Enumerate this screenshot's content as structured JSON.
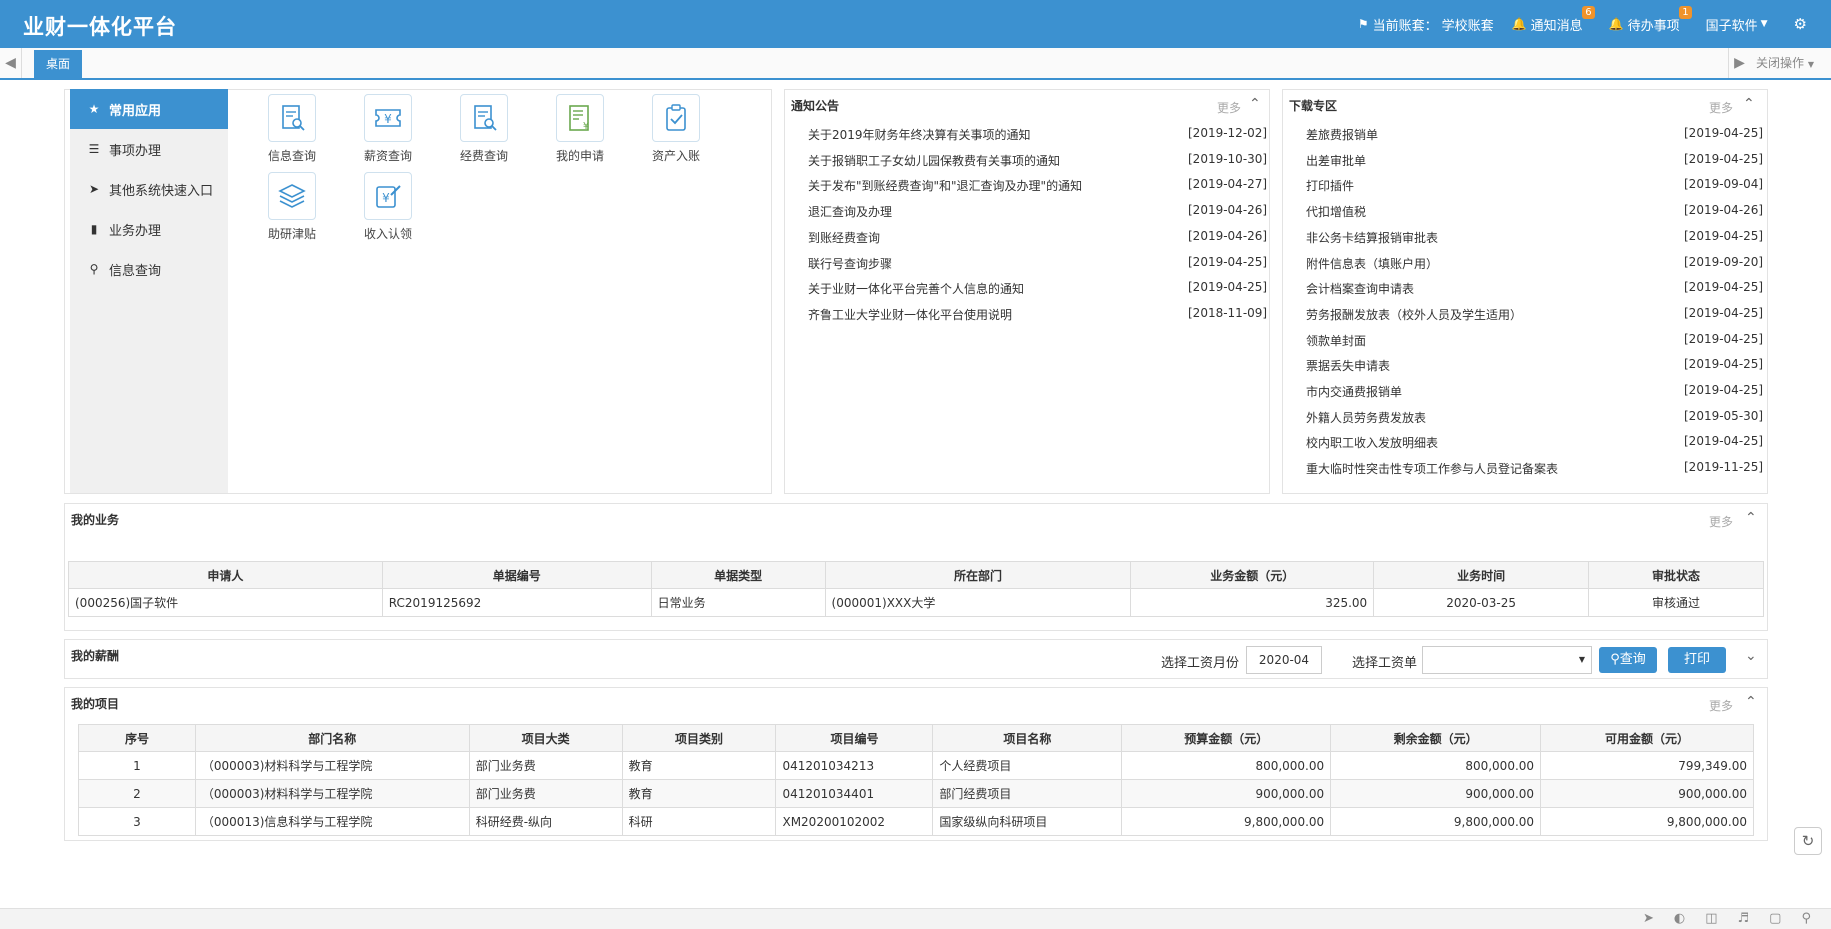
{
  "header": {
    "title": "业财一体化平台",
    "account_label": "当前账套：",
    "account_value": "学校账套",
    "notify_label": "通知消息",
    "notify_count": "6",
    "todo_label": "待办事项",
    "todo_count": "1",
    "user_label": "国子软件"
  },
  "tabs": {
    "active_tab": "桌面",
    "close_ops": "关闭操作"
  },
  "app_menu": {
    "items": [
      {
        "label": "常用应用",
        "icon": "star-icon"
      },
      {
        "label": "事项办理",
        "icon": "list-icon"
      },
      {
        "label": "其他系统快速入口",
        "icon": "arrow-up-circle-icon"
      },
      {
        "label": "业务办理",
        "icon": "book-icon"
      },
      {
        "label": "信息查询",
        "icon": "search-icon"
      }
    ]
  },
  "apps": [
    {
      "label": "信息查询",
      "icon": "document-search-icon"
    },
    {
      "label": "薪资查询",
      "icon": "yen-ticket-icon"
    },
    {
      "label": "经费查询",
      "icon": "document-search-icon"
    },
    {
      "label": "我的申请",
      "icon": "list-yen-icon"
    },
    {
      "label": "资产入账",
      "icon": "clipboard-check-icon"
    },
    {
      "label": "助研津贴",
      "icon": "layers-icon"
    },
    {
      "label": "收入认领",
      "icon": "yen-edit-icon"
    }
  ],
  "notices": {
    "title": "通知公告",
    "more": "更多",
    "items": [
      {
        "text": "关于2019年财务年终决算有关事项的通知",
        "date": "[2019-12-02]"
      },
      {
        "text": "关于报销职工子女幼儿园保教费有关事项的通知",
        "date": "[2019-10-30]"
      },
      {
        "text": "关于发布\"到账经费查询\"和\"退汇查询及办理\"的通知",
        "date": "[2019-04-27]"
      },
      {
        "text": "退汇查询及办理",
        "date": "[2019-04-26]"
      },
      {
        "text": "到账经费查询",
        "date": "[2019-04-26]"
      },
      {
        "text": "联行号查询步骤",
        "date": "[2019-04-25]"
      },
      {
        "text": "关于业财一体化平台完善个人信息的通知",
        "date": "[2019-04-25]"
      },
      {
        "text": "齐鲁工业大学业财一体化平台使用说明",
        "date": "[2018-11-09]"
      }
    ]
  },
  "downloads": {
    "title": "下载专区",
    "more": "更多",
    "items": [
      {
        "text": "差旅费报销单",
        "date": "[2019-04-25]"
      },
      {
        "text": "出差审批单",
        "date": "[2019-04-25]"
      },
      {
        "text": "打印插件",
        "date": "[2019-09-04]"
      },
      {
        "text": "代扣增值税",
        "date": "[2019-04-26]"
      },
      {
        "text": "非公务卡结算报销审批表",
        "date": "[2019-04-25]"
      },
      {
        "text": "附件信息表（填账户用）",
        "date": "[2019-09-20]"
      },
      {
        "text": "会计档案查询申请表",
        "date": "[2019-04-25]"
      },
      {
        "text": "劳务报酬发放表（校外人员及学生适用）",
        "date": "[2019-04-25]"
      },
      {
        "text": "领款单封面",
        "date": "[2019-04-25]"
      },
      {
        "text": "票据丢失申请表",
        "date": "[2019-04-25]"
      },
      {
        "text": "市内交通费报销单",
        "date": "[2019-04-25]"
      },
      {
        "text": "外籍人员劳务费发放表",
        "date": "[2019-05-30]"
      },
      {
        "text": "校内职工收入发放明细表",
        "date": "[2019-04-25]"
      },
      {
        "text": "重大临时性突击性专项工作参与人员登记备案表",
        "date": "[2019-11-25]"
      }
    ]
  },
  "my_business": {
    "title": "我的业务",
    "more": "更多",
    "columns": [
      "申请人",
      "单据编号",
      "单据类型",
      "所在部门",
      "业务金额（元）",
      "业务时间",
      "审批状态"
    ],
    "rows": [
      [
        "(000256)国子软件",
        "RC2019125692",
        "日常业务",
        "(000001)XXX大学",
        "325.00",
        "2020-03-25",
        "审核通过"
      ]
    ]
  },
  "my_salary": {
    "title": "我的薪酬",
    "month_label": "选择工资月份",
    "month_value": "2020-04",
    "sheet_label": "选择工资单",
    "sheet_value": "",
    "query_label": "查询",
    "print_label": "打印"
  },
  "my_projects": {
    "title": "我的项目",
    "more": "更多",
    "columns": [
      "序号",
      "部门名称",
      "项目大类",
      "项目类别",
      "项目编号",
      "项目名称",
      "预算金额（元）",
      "剩余金额（元）",
      "可用金额（元）"
    ],
    "rows": [
      [
        "1",
        "（000003)材料科学与工程学院",
        "部门业务费",
        "教育",
        "041201034213",
        "个人经费项目",
        "800,000.00",
        "800,000.00",
        "799,349.00"
      ],
      [
        "2",
        "（000003)材料科学与工程学院",
        "部门业务费",
        "教育",
        "041201034401",
        "部门经费项目",
        "900,000.00",
        "900,000.00",
        "900,000.00"
      ],
      [
        "3",
        "（000013)信息科学与工程学院",
        "科研经费-纵向",
        "科研",
        "XM20200102002",
        "国家级纵向科研项目",
        "9,800,000.00",
        "9,800,000.00",
        "9,800,000.00"
      ]
    ]
  }
}
